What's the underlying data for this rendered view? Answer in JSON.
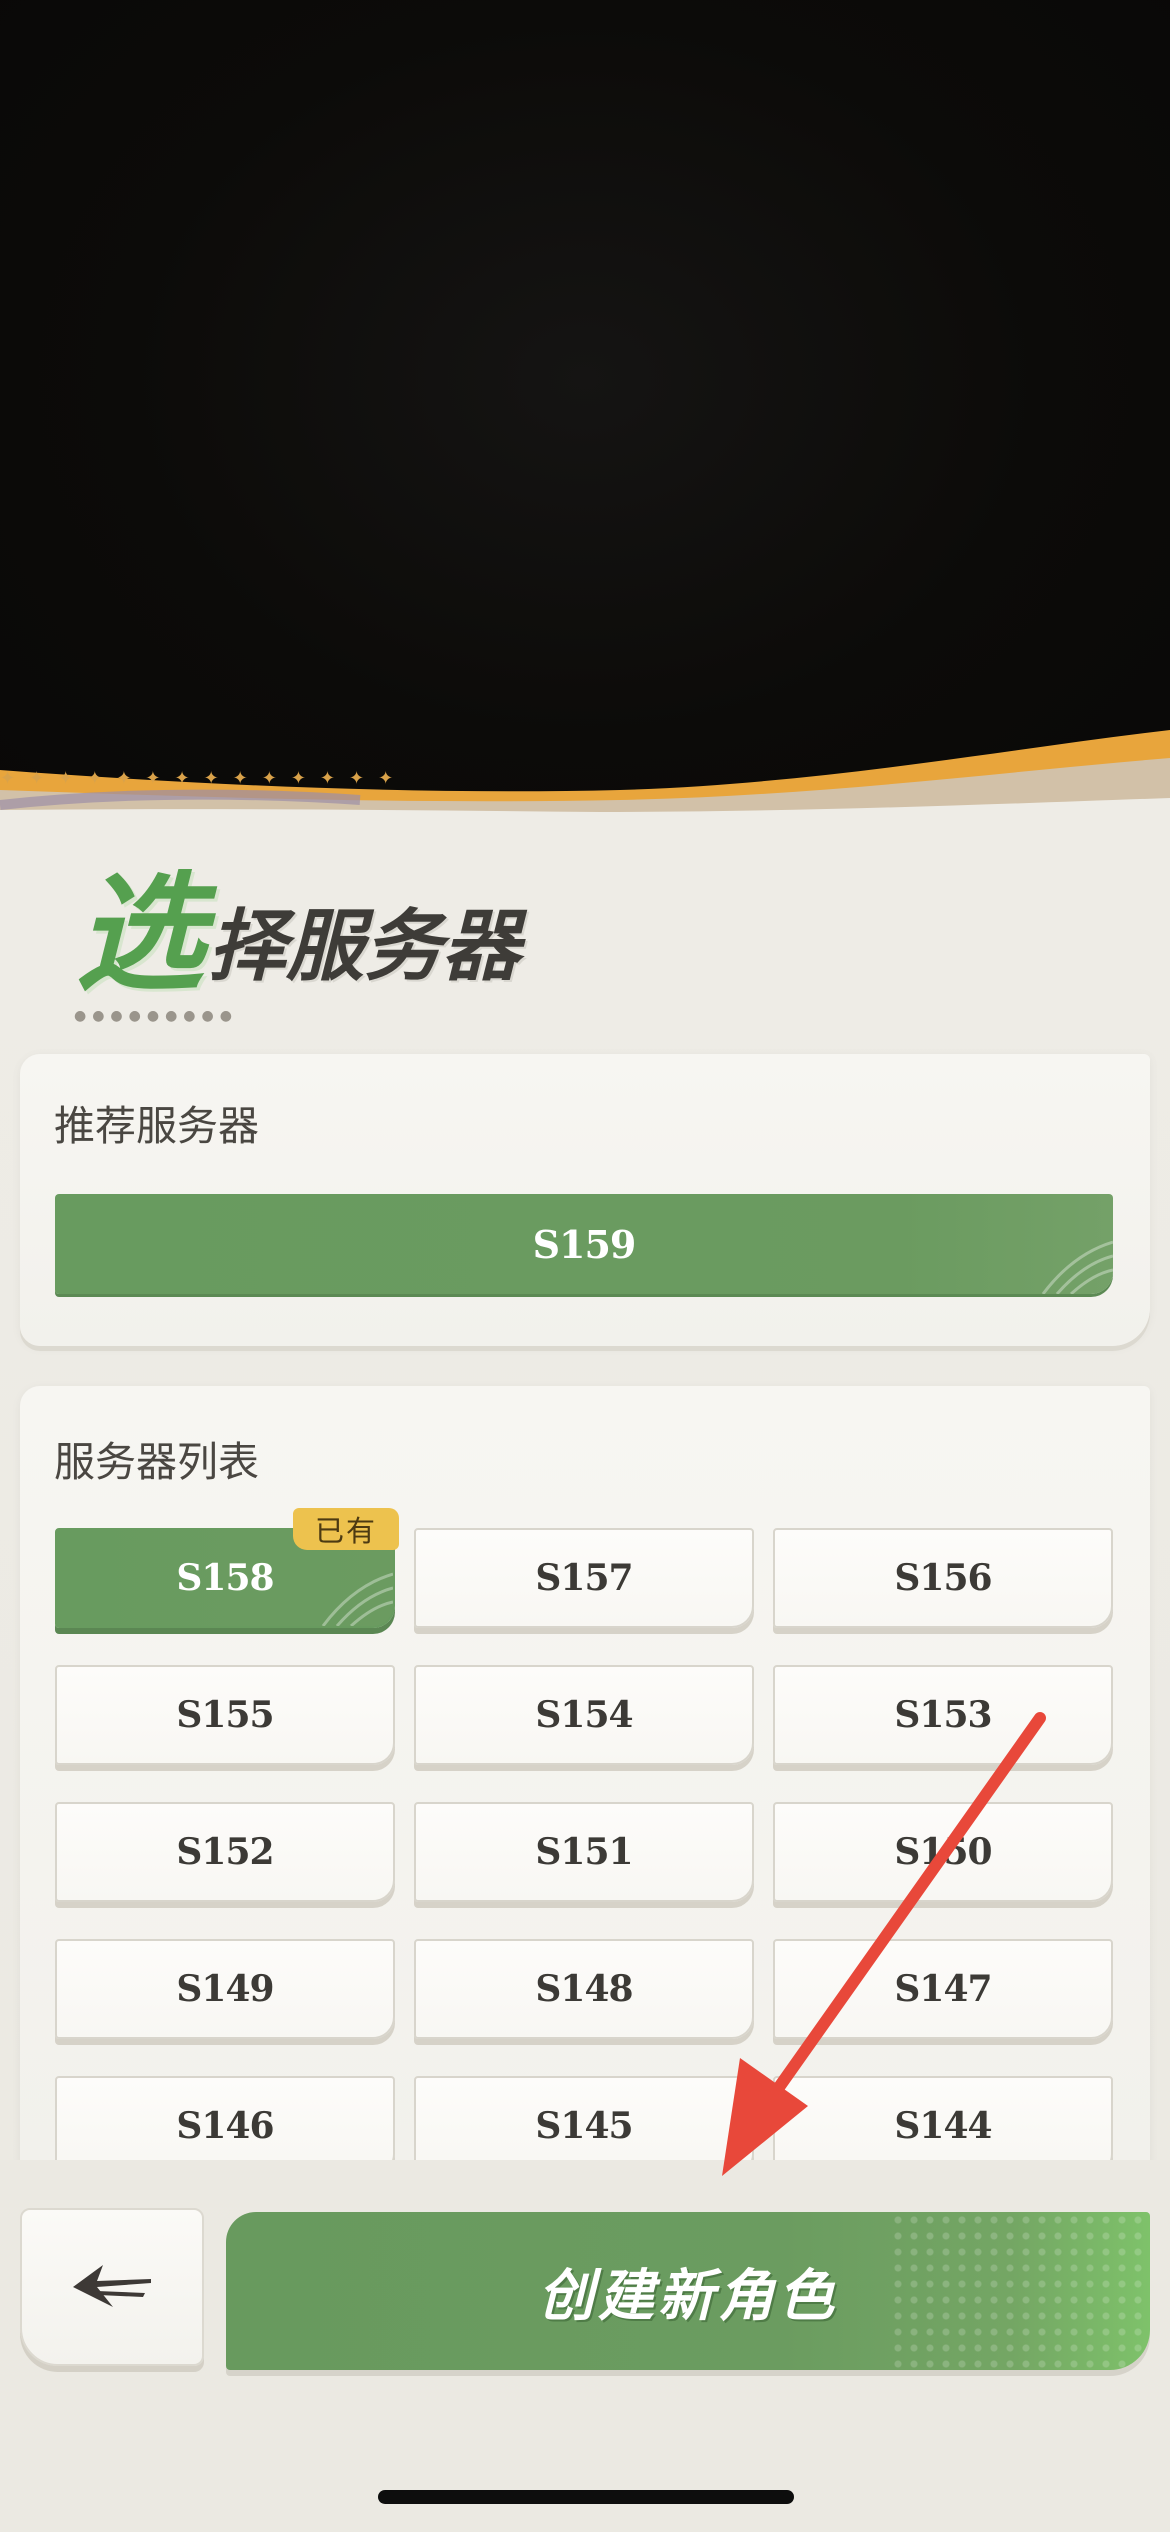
{
  "title": {
    "first_char": "选",
    "rest": "择服务器"
  },
  "recommended": {
    "label": "推荐服务器",
    "server": "S159"
  },
  "server_list": {
    "label": "服务器列表",
    "owned_badge": "已有",
    "servers": [
      "S158",
      "S157",
      "S156",
      "S155",
      "S154",
      "S153",
      "S152",
      "S151",
      "S150",
      "S149",
      "S148",
      "S147",
      "S146",
      "S145",
      "S144"
    ]
  },
  "bottom_bar": {
    "back_icon": "back-arrow-icon",
    "create_label": "创建新角色"
  },
  "colors": {
    "accent_green": "#689b5f",
    "badge_yellow": "#edc24e",
    "annotation_red": "#e8483a",
    "wave_orange": "#e7a63a"
  }
}
